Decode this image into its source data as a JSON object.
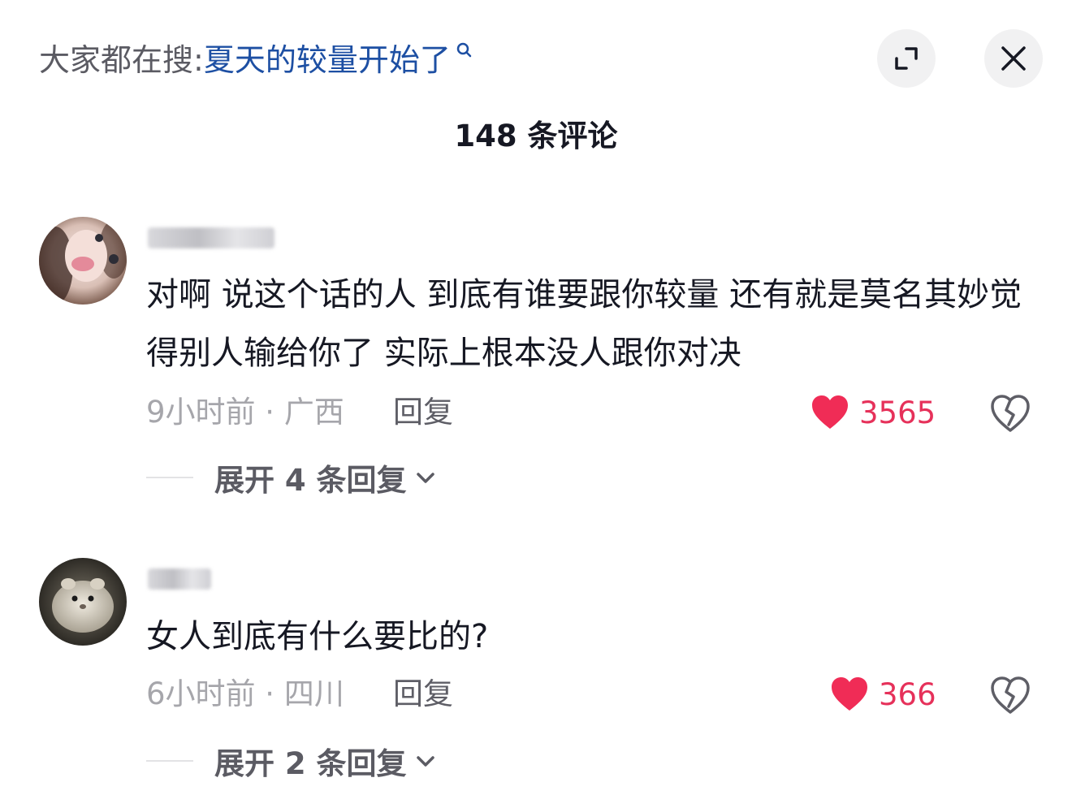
{
  "search": {
    "prefix": "大家都在搜:",
    "query": "夏天的较量开始了"
  },
  "header": {
    "comment_count": "148 条评论"
  },
  "comments": [
    {
      "text": "对啊 说这个话的人 到底有谁要跟你较量 还有就是莫名其妙觉得别人输给你了 实际上根本没人跟你对决",
      "time_location": "9小时前 · 广西",
      "reply_label": "回复",
      "likes": "3565",
      "expand_label": "展开 4 条回复"
    },
    {
      "text": "女人到底有什么要比的?",
      "time_location": "6小时前 · 四川",
      "reply_label": "回复",
      "likes": "366",
      "expand_label": "展开 2 条回复"
    }
  ],
  "icons": {
    "search": "magnifier-icon",
    "expand": "expand-icon",
    "close": "close-icon",
    "like": "heart-icon",
    "dislike": "broken-heart-icon",
    "chevron": "chevron-down-icon"
  },
  "colors": {
    "query": "#1d4fa3",
    "like": "#e6315a",
    "muted": "#a6a6ab"
  }
}
